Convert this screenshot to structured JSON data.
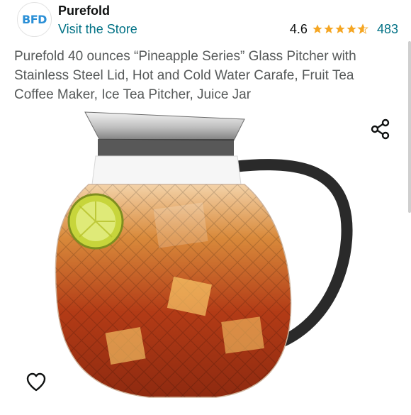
{
  "store": {
    "logo_text": "BFD",
    "name": "Purefold",
    "visit_label": "Visit the Store"
  },
  "rating": {
    "value": "4.6",
    "stars": 4.6,
    "count": "483",
    "star_color": "#f5a623"
  },
  "product": {
    "title": "Purefold 40 ounces “Pineapple Series” Glass Pitcher with Stainless Steel Lid, Hot and Cold Water Carafe, Fruit Tea Coffee Maker, Ice Tea Pitcher, Juice Jar"
  },
  "icons": {
    "share": "share-icon",
    "heart": "heart-icon"
  },
  "colors": {
    "link": "#007185",
    "text": "#0f1111",
    "muted": "#565959"
  }
}
